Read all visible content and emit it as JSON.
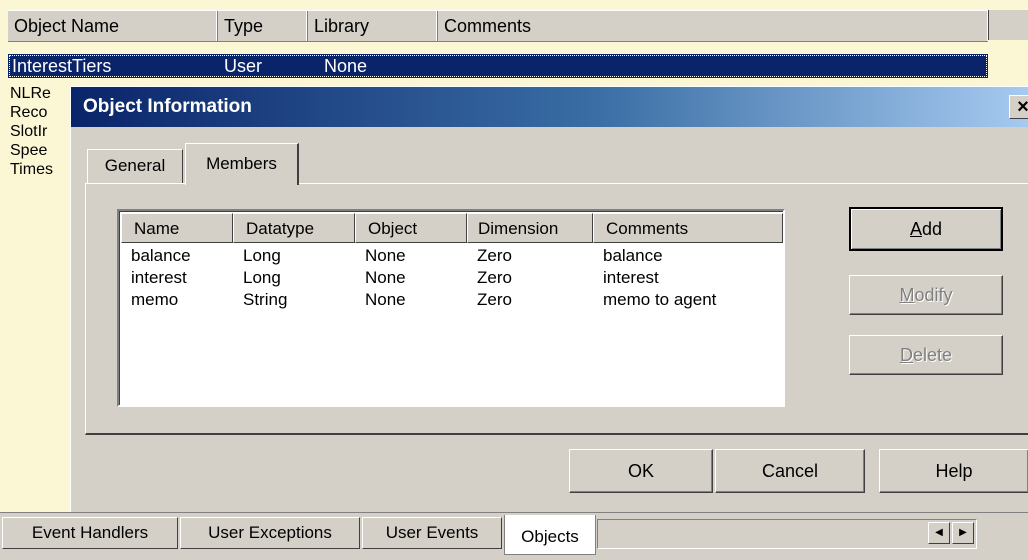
{
  "background_list": {
    "columns": [
      "Object Name",
      "Type",
      "Library",
      "Comments"
    ],
    "selected_row": {
      "name": "InterestTiers",
      "type": "User",
      "library": "None"
    },
    "other_names": [
      "NLRe",
      "Reco",
      "SlotIr",
      "Spee",
      "Times"
    ]
  },
  "dialog": {
    "title": "Object Information",
    "close_label": "×",
    "tabs": [
      {
        "label": "General",
        "active": false
      },
      {
        "label": "Members",
        "active": true
      }
    ],
    "members": {
      "columns": [
        "Name",
        "Datatype",
        "Object",
        "Dimension",
        "Comments"
      ],
      "rows": [
        {
          "name": "balance",
          "datatype": "Long",
          "object": "None",
          "dimension": "Zero",
          "comments": "balance"
        },
        {
          "name": "interest",
          "datatype": "Long",
          "object": "None",
          "dimension": "Zero",
          "comments": "interest"
        },
        {
          "name": "memo",
          "datatype": "String",
          "object": "None",
          "dimension": "Zero",
          "comments": "memo to agent"
        }
      ]
    },
    "side_buttons": {
      "add": {
        "pre": "",
        "key": "A",
        "post": "dd",
        "enabled": true
      },
      "modify": {
        "pre": "",
        "key": "M",
        "post": "odify",
        "enabled": false
      },
      "delete": {
        "pre": "",
        "key": "D",
        "post": "elete",
        "enabled": false
      }
    },
    "ok_label": "OK",
    "cancel_label": "Cancel",
    "help_label": "Help"
  },
  "bottom_tabs": [
    {
      "label": "Event Handlers",
      "active": false
    },
    {
      "label": "User Exceptions",
      "active": false
    },
    {
      "label": "User Events",
      "active": false
    },
    {
      "label": "Objects",
      "active": true
    }
  ],
  "scroll_icons": {
    "left": "arrow-left-icon",
    "right": "arrow-right-icon"
  },
  "colors": {
    "selection": "#0a246a",
    "list_background": "#fbf7d5",
    "dialog_face": "#d4d0c8"
  }
}
